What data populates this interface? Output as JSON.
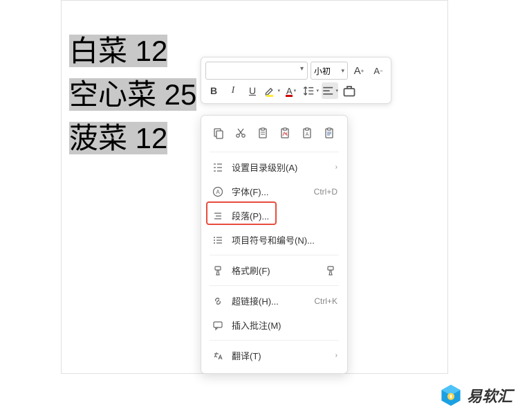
{
  "document": {
    "lines": [
      "白菜 12",
      "空心菜 25",
      "菠菜 12"
    ]
  },
  "mini_toolbar": {
    "font_name": "",
    "font_size": "小初",
    "grow": "A⁺",
    "shrink": "A⁻",
    "bold": "B",
    "italic": "I",
    "underline": "U"
  },
  "context_menu": {
    "items": [
      {
        "key": "outline",
        "label": "设置目录级别(A)",
        "arrow": true
      },
      {
        "key": "font",
        "label": "字体(F)...",
        "shortcut": "Ctrl+D"
      },
      {
        "key": "paragraph",
        "label": "段落(P)...",
        "highlighted": true
      },
      {
        "key": "bullets",
        "label": "项目符号和编号(N)..."
      },
      {
        "key": "format-painter",
        "label": "格式刷(F)",
        "brush": true
      },
      {
        "key": "hyperlink",
        "label": "超链接(H)...",
        "shortcut": "Ctrl+K"
      },
      {
        "key": "comment",
        "label": "插入批注(M)"
      },
      {
        "key": "translate",
        "label": "翻译(T)",
        "arrow": true
      }
    ]
  },
  "watermark": {
    "text": "易软汇"
  }
}
